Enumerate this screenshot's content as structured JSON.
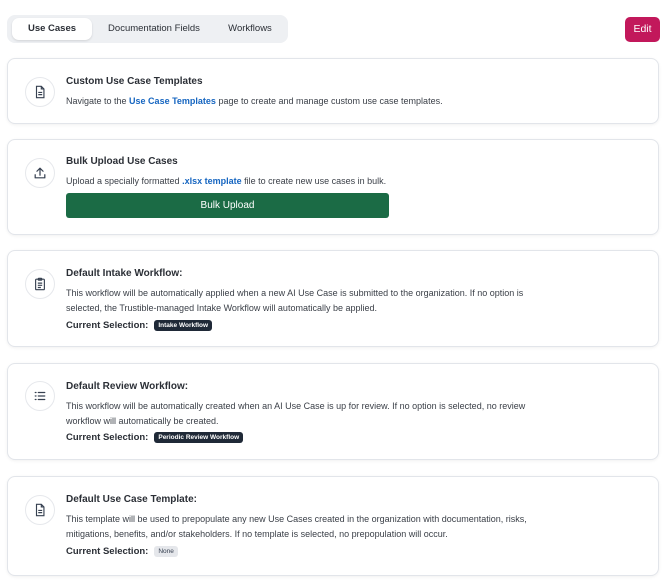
{
  "tabs": [
    {
      "label": "Use Cases",
      "active": true
    },
    {
      "label": "Documentation Fields",
      "active": false
    },
    {
      "label": "Workflows",
      "active": false
    }
  ],
  "edit_label": "Edit",
  "colors": {
    "accent": "#c2185b",
    "primary_button": "#1b6b45",
    "link": "#1565c0"
  },
  "cards": {
    "templates": {
      "icon": "document-icon",
      "title": "Custom Use Case Templates",
      "desc_prefix": "Navigate to the ",
      "link": "Use Case Templates",
      "desc_suffix": " page to create and manage custom use case templates."
    },
    "bulk": {
      "icon": "upload-icon",
      "title": "Bulk Upload Use Cases",
      "desc_prefix": "Upload a specially formatted ",
      "link": ".xlsx template",
      "desc_suffix": " file to create new use cases in bulk.",
      "button": "Bulk Upload"
    },
    "intake": {
      "icon": "clipboard-icon",
      "title": "Default Intake Workflow:",
      "desc": "This workflow will be automatically applied when a new AI Use Case is submitted to the organization. If no option is selected, the Trustible-managed Intake Workflow will automatically be applied.",
      "selection_label": "Current Selection:",
      "selection_value": "Intake Workflow"
    },
    "review": {
      "icon": "list-icon",
      "title": "Default Review Workflow:",
      "desc": "This workflow will be automatically created when an AI Use Case is up for review. If no option is selected, no review workflow will automatically be created.",
      "selection_label": "Current Selection:",
      "selection_value": "Periodic Review Workflow"
    },
    "default_template": {
      "icon": "document-icon",
      "title": "Default Use Case Template:",
      "desc": "This template will be used to prepopulate any new Use Cases created in the organization with documentation, risks, mitigations, benefits, and/or stakeholders. If no template is selected, no prepopulation will occur.",
      "selection_label": "Current Selection:",
      "selection_value": "None"
    }
  }
}
